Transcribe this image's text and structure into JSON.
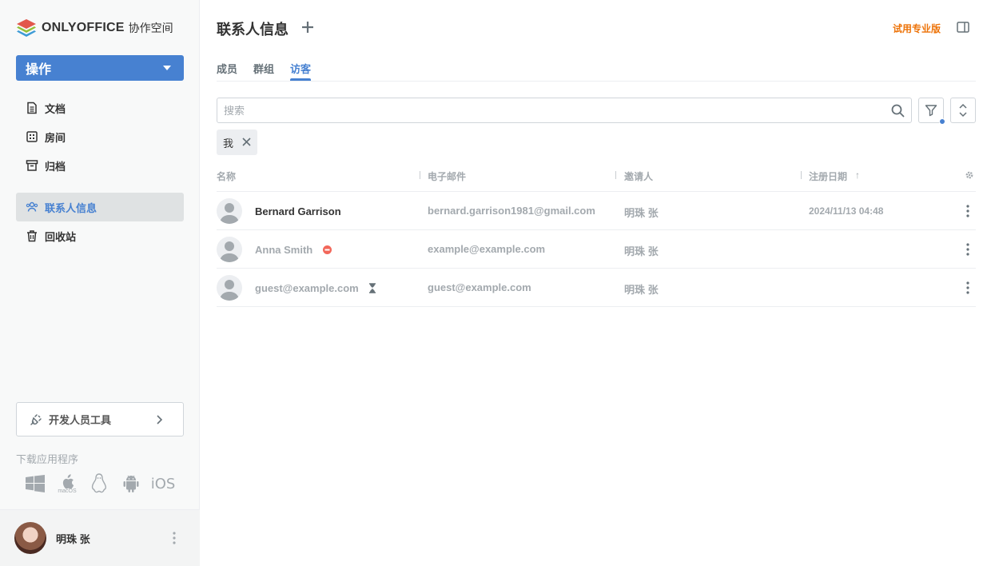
{
  "logo": {
    "brand": "ONLYOFFICE",
    "product": "协作空间"
  },
  "sidebar": {
    "action_label": "操作",
    "items": [
      {
        "label": "文档",
        "icon": "document-icon"
      },
      {
        "label": "房间",
        "icon": "rooms-icon"
      },
      {
        "label": "归档",
        "icon": "archive-icon"
      },
      {
        "label": "联系人信息",
        "icon": "contacts-icon",
        "active": true
      },
      {
        "label": "回收站",
        "icon": "trash-icon"
      }
    ],
    "dev_tools_label": "开发人员工具",
    "download_title": "下载应用程序",
    "apps": [
      "windows-icon",
      "macos-icon",
      "linux-icon",
      "android-icon",
      "iOS"
    ],
    "macos_caption": "macOS",
    "ios_label": "iOS"
  },
  "profile": {
    "name": "明珠 张"
  },
  "header": {
    "title": "联系人信息",
    "trial_label": "试用专业版"
  },
  "tabs": [
    {
      "label": "成员"
    },
    {
      "label": "群组"
    },
    {
      "label": "访客",
      "active": true
    }
  ],
  "search": {
    "placeholder": "搜索",
    "value": ""
  },
  "filter_chip": {
    "label": "我"
  },
  "table": {
    "columns": [
      "名称",
      "电子邮件",
      "邀请人",
      "注册日期"
    ],
    "sort_indicator": "↑",
    "rows": [
      {
        "name": "Bernard Garrison",
        "email": "bernard.garrison1981@gmail.com",
        "inviter": "明珠 张",
        "date": "2024/11/13 04:48",
        "status": "active"
      },
      {
        "name": "Anna Smith",
        "email": "example@example.com",
        "inviter": "明珠 张",
        "date": "",
        "status": "disabled"
      },
      {
        "name": "guest@example.com",
        "email": "guest@example.com",
        "inviter": "明珠 张",
        "date": "",
        "status": "pending"
      }
    ]
  },
  "colors": {
    "accent": "#4781d1",
    "trial": "#ed7309",
    "disabled_badge": "#f2675a",
    "muted": "#a3a9ae"
  }
}
